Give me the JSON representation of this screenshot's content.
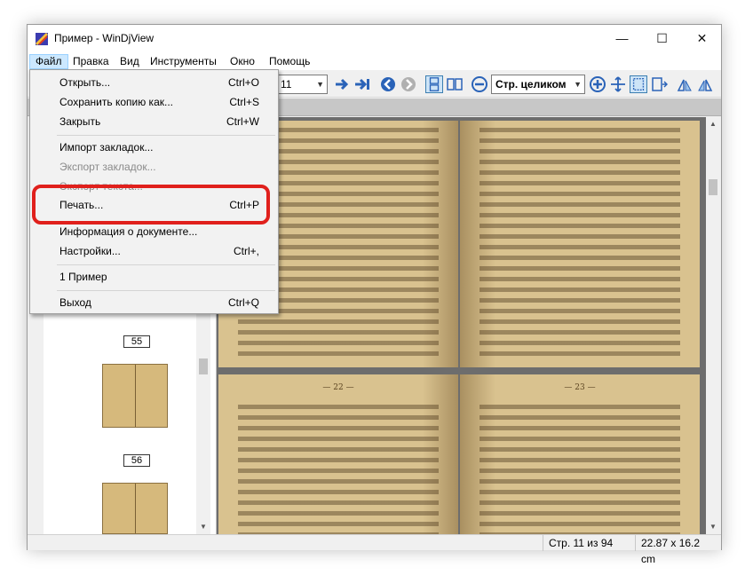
{
  "window": {
    "title": "Пример - WinDjView",
    "controls": {
      "minimize": "—",
      "maximize": "☐",
      "close": "✕"
    }
  },
  "menubar": [
    "Файл",
    "Правка",
    "Вид",
    "Инструменты",
    "Окно",
    "Помощь"
  ],
  "toolbar": {
    "page_field": "11",
    "zoom_field": "Стр. целиком",
    "icons": [
      "next-page-icon",
      "last-page-icon",
      "back-icon",
      "forward-icon",
      "continuous-layout-icon",
      "facing-pages-icon",
      "zoom-out-icon",
      "zoom-in-icon",
      "pan-icon",
      "select-icon",
      "fit-page-icon",
      "rotate-left-icon",
      "rotate-right-icon"
    ]
  },
  "file_menu": {
    "items": [
      {
        "label": "Открыть...",
        "shortcut": "Ctrl+O",
        "enabled": true
      },
      {
        "label": "Сохранить копию как...",
        "shortcut": "Ctrl+S",
        "enabled": true
      },
      {
        "label": "Закрыть",
        "shortcut": "Ctrl+W",
        "enabled": true
      },
      {
        "label": "Импорт закладок...",
        "shortcut": "",
        "enabled": true
      },
      {
        "label": "Экспорт закладок...",
        "shortcut": "",
        "enabled": false
      },
      {
        "label": "Экспорт текста...",
        "shortcut": "",
        "enabled": false
      },
      {
        "label": "Печать...",
        "shortcut": "Ctrl+P",
        "enabled": true
      },
      {
        "label": "Информация о документе...",
        "shortcut": "",
        "enabled": true
      },
      {
        "label": "Настройки...",
        "shortcut": "Ctrl+,",
        "enabled": true
      },
      {
        "label": "1 Пример",
        "shortcut": "",
        "enabled": true
      },
      {
        "label": "Выход",
        "shortcut": "Ctrl+Q",
        "enabled": true
      }
    ],
    "highlight_color": "#e0201c"
  },
  "thumbnails": [
    {
      "label": "55"
    },
    {
      "label": "56"
    }
  ],
  "document": {
    "page_numbers": [
      "— 22 —",
      "— 23 —"
    ]
  },
  "statusbar": {
    "page": "Стр. 11 из 94",
    "size": "22.87 x 16.2 cm"
  },
  "colors": {
    "accent": "#3c7fb1",
    "paper": "#d9c28f",
    "menu_selected": "#cce8ff"
  }
}
